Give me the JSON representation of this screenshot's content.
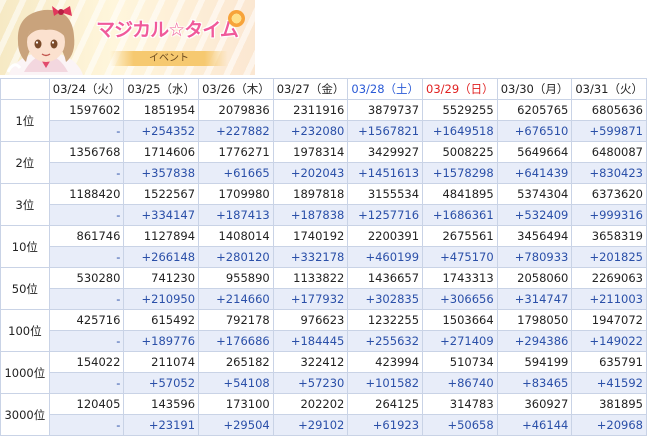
{
  "banner": {
    "logo_text": "マジカル☆タイム",
    "tag_text": "イベント"
  },
  "table": {
    "dates": [
      {
        "label": "03/24（火）",
        "kind": "weekday"
      },
      {
        "label": "03/25（水）",
        "kind": "weekday"
      },
      {
        "label": "03/26（木）",
        "kind": "weekday"
      },
      {
        "label": "03/27（金）",
        "kind": "weekday"
      },
      {
        "label": "03/28（土）",
        "kind": "sat"
      },
      {
        "label": "03/29（日）",
        "kind": "sun"
      },
      {
        "label": "03/30（月）",
        "kind": "weekday"
      },
      {
        "label": "03/31（火）",
        "kind": "weekday"
      }
    ],
    "rows": [
      {
        "rank": "1位",
        "values": [
          "1597602",
          "1851954",
          "2079836",
          "2311916",
          "3879737",
          "5529255",
          "6205765",
          "6805636"
        ],
        "diffs": [
          "-",
          "+254352",
          "+227882",
          "+232080",
          "+1567821",
          "+1649518",
          "+676510",
          "+599871"
        ]
      },
      {
        "rank": "2位",
        "values": [
          "1356768",
          "1714606",
          "1776271",
          "1978314",
          "3429927",
          "5008225",
          "5649664",
          "6480087"
        ],
        "diffs": [
          "-",
          "+357838",
          "+61665",
          "+202043",
          "+1451613",
          "+1578298",
          "+641439",
          "+830423"
        ]
      },
      {
        "rank": "3位",
        "values": [
          "1188420",
          "1522567",
          "1709980",
          "1897818",
          "3155534",
          "4841895",
          "5374304",
          "6373620"
        ],
        "diffs": [
          "-",
          "+334147",
          "+187413",
          "+187838",
          "+1257716",
          "+1686361",
          "+532409",
          "+999316"
        ]
      },
      {
        "rank": "10位",
        "values": [
          "861746",
          "1127894",
          "1408014",
          "1740192",
          "2200391",
          "2675561",
          "3456494",
          "3658319"
        ],
        "diffs": [
          "-",
          "+266148",
          "+280120",
          "+332178",
          "+460199",
          "+475170",
          "+780933",
          "+201825"
        ]
      },
      {
        "rank": "50位",
        "values": [
          "530280",
          "741230",
          "955890",
          "1133822",
          "1436657",
          "1743313",
          "2058060",
          "2269063"
        ],
        "diffs": [
          "-",
          "+210950",
          "+214660",
          "+177932",
          "+302835",
          "+306656",
          "+314747",
          "+211003"
        ]
      },
      {
        "rank": "100位",
        "values": [
          "425716",
          "615492",
          "792178",
          "976623",
          "1232255",
          "1503664",
          "1798050",
          "1947072"
        ],
        "diffs": [
          "-",
          "+189776",
          "+176686",
          "+184445",
          "+255632",
          "+271409",
          "+294386",
          "+149022"
        ]
      },
      {
        "rank": "1000位",
        "values": [
          "154022",
          "211074",
          "265182",
          "322412",
          "423994",
          "510734",
          "594199",
          "635791"
        ],
        "diffs": [
          "-",
          "+57052",
          "+54108",
          "+57230",
          "+101582",
          "+86740",
          "+83465",
          "+41592"
        ]
      },
      {
        "rank": "3000位",
        "values": [
          "120405",
          "143596",
          "173100",
          "202202",
          "264125",
          "314783",
          "360927",
          "381895"
        ],
        "diffs": [
          "-",
          "+23191",
          "+29504",
          "+29102",
          "+61923",
          "+50658",
          "+46144",
          "+20968"
        ]
      }
    ]
  }
}
